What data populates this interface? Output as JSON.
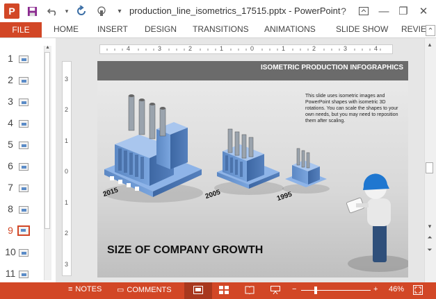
{
  "window": {
    "title": "production_line_isometrics_17515.pptx - PowerPoint",
    "app_icon_letter": "P",
    "buttons": {
      "help": "?",
      "minimize": "—",
      "restore": "❐",
      "close": "✕"
    }
  },
  "quick_access": {
    "save_icon": "save-icon",
    "undo_icon": "undo-icon",
    "redo_icon": "redo-icon",
    "touch_icon": "touch-mode-icon",
    "customize_icon": "customize-icon"
  },
  "ribbon": {
    "file": "FILE",
    "tabs": [
      "HOME",
      "INSERT",
      "DESIGN",
      "TRANSITIONS",
      "ANIMATIONS",
      "SLIDE SHOW",
      "REVIEW"
    ],
    "collapse_glyph": "⌃"
  },
  "thumbnails": {
    "numbers": [
      "1",
      "2",
      "3",
      "4",
      "5",
      "6",
      "7",
      "8",
      "9",
      "10",
      "11"
    ],
    "active": "9",
    "scroll_up": "▴"
  },
  "rulers": {
    "horizontal": [
      "4",
      "3",
      "2",
      "1",
      "0",
      "1",
      "2",
      "3",
      "4"
    ],
    "vertical": [
      "3",
      "2",
      "1",
      "0",
      "1",
      "2",
      "3"
    ]
  },
  "slide": {
    "header": "ISOMETRIC PRODUCTION INFOGRAPHICS",
    "description": "This slide uses isometric images and PowerPoint shapes with isometric 3D rotations. You can scale the shapes to your own needs, but you may need to reposition them after scaling.",
    "heading": "SIZE OF COMPANY GROWTH",
    "years": [
      "2015",
      "2005",
      "1995"
    ],
    "colors": {
      "header": "#6b6b6b",
      "factory": "#6f9ad6",
      "factory_dark": "#3f6ba8",
      "helmet": "#1f77d0"
    }
  },
  "scrollbar": {
    "up": "▴",
    "down": "▾",
    "page_up": "⏶",
    "page_down": "⏷"
  },
  "status": {
    "notes": "NOTES",
    "comments": "COMMENTS",
    "zoom_minus": "−",
    "zoom_plus": "+",
    "zoom_level": "46%",
    "zoom_fraction": 0.46,
    "accent": "#d24726"
  }
}
